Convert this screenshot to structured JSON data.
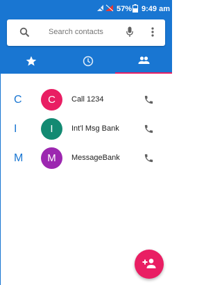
{
  "status_bar": {
    "battery_percent": "57%",
    "time": "9:49 am"
  },
  "search": {
    "placeholder": "Search contacts"
  },
  "tabs": [
    {
      "icon": "star-icon",
      "selected": false
    },
    {
      "icon": "clock-icon",
      "selected": false
    },
    {
      "icon": "people-icon",
      "selected": true
    }
  ],
  "contacts": [
    {
      "section_letter": "C",
      "avatar_letter": "C",
      "avatar_color": "#e91e63",
      "name": "Call 1234"
    },
    {
      "section_letter": "I",
      "avatar_letter": "I",
      "avatar_color": "#138a72",
      "name": "Int'l Msg Bank"
    },
    {
      "section_letter": "M",
      "avatar_letter": "M",
      "avatar_color": "#9c27b0",
      "name": "MessageBank"
    }
  ],
  "colors": {
    "primary": "#1976d2",
    "accent": "#e91e63"
  }
}
